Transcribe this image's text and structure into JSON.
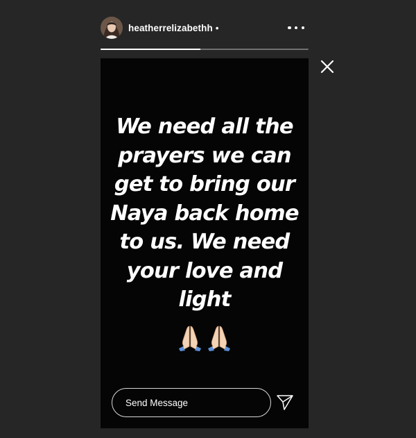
{
  "header": {
    "username": "heatherrelizabethh",
    "separator": "•",
    "avatar_icon": "profile-photo",
    "more_icon": "more-horizontal-icon"
  },
  "progress": {
    "fraction": 0.48
  },
  "controls": {
    "close_icon": "close-icon",
    "send_icon": "paper-plane-icon"
  },
  "story": {
    "text_lines": [
      "We need all the",
      "prayers we can",
      "get to bring our",
      "Naya back home",
      "to us. We need",
      "your love and",
      "light"
    ],
    "emojis": [
      "folded-hands-emoji",
      "folded-hands-emoji"
    ]
  },
  "reply": {
    "placeholder": "Send Message"
  },
  "colors": {
    "page_background": "#262626",
    "story_background": "#050505",
    "text": "#ffffff"
  }
}
